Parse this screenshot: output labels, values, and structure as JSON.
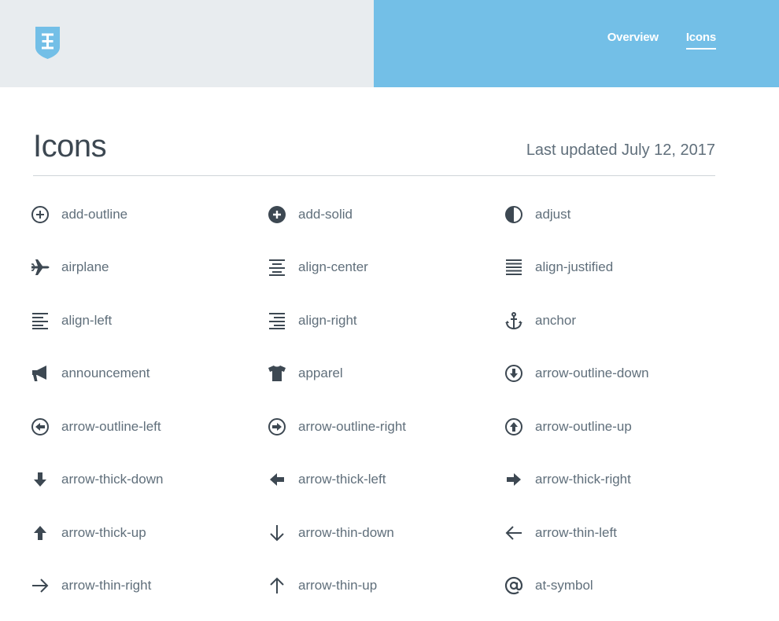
{
  "header": {
    "nav": [
      {
        "label": "Overview"
      },
      {
        "label": "Icons"
      }
    ]
  },
  "page": {
    "title": "Icons",
    "updated": "Last updated July 12, 2017"
  },
  "icons": [
    {
      "label": "add-outline"
    },
    {
      "label": "add-solid"
    },
    {
      "label": "adjust"
    },
    {
      "label": "airplane"
    },
    {
      "label": "align-center"
    },
    {
      "label": "align-justified"
    },
    {
      "label": "align-left"
    },
    {
      "label": "align-right"
    },
    {
      "label": "anchor"
    },
    {
      "label": "announcement"
    },
    {
      "label": "apparel"
    },
    {
      "label": "arrow-outline-down"
    },
    {
      "label": "arrow-outline-left"
    },
    {
      "label": "arrow-outline-right"
    },
    {
      "label": "arrow-outline-up"
    },
    {
      "label": "arrow-thick-down"
    },
    {
      "label": "arrow-thick-left"
    },
    {
      "label": "arrow-thick-right"
    },
    {
      "label": "arrow-thick-up"
    },
    {
      "label": "arrow-thin-down"
    },
    {
      "label": "arrow-thin-left"
    },
    {
      "label": "arrow-thin-right"
    },
    {
      "label": "arrow-thin-up"
    },
    {
      "label": "at-symbol"
    }
  ],
  "colors": {
    "header_left_bg": "#e8ecef",
    "header_right_bg": "#73bfe7",
    "icon": "#3d4852",
    "label": "#606f7b"
  }
}
